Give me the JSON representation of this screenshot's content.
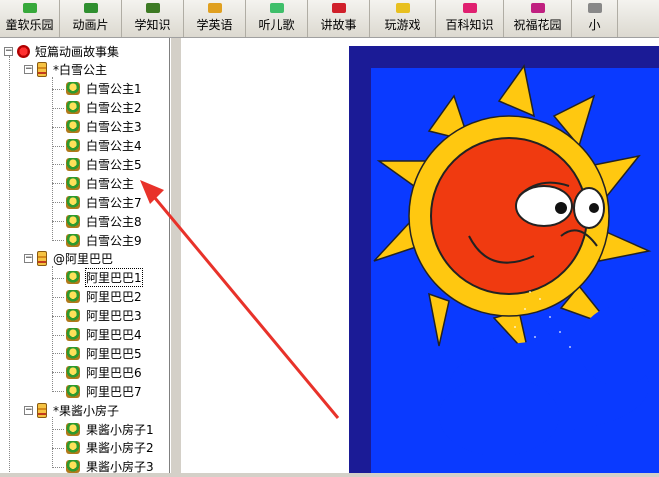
{
  "toolbar": {
    "items": [
      {
        "label": "童软乐园",
        "icon": "kids-park-icon",
        "color": "#37a93b"
      },
      {
        "label": "动画片",
        "icon": "cartoon-icon",
        "color": "#2f8f2f"
      },
      {
        "label": "学知识",
        "icon": "knowledge-icon",
        "color": "#3d7a23"
      },
      {
        "label": "学英语",
        "icon": "english-icon",
        "color": "#e0a020"
      },
      {
        "label": "听儿歌",
        "icon": "song-icon",
        "color": "#3fbf6a"
      },
      {
        "label": "讲故事",
        "icon": "story-icon",
        "color": "#d0202a"
      },
      {
        "label": "玩游戏",
        "icon": "game-icon",
        "color": "#e8c020"
      },
      {
        "label": "百科知识",
        "icon": "encyclopedia-icon",
        "color": "#e02070"
      },
      {
        "label": "祝福花园",
        "icon": "blessing-garden-icon",
        "color": "#c02080"
      },
      {
        "label": "小",
        "icon": "",
        "color": "#888888"
      }
    ]
  },
  "tree": {
    "root": "短篇动画故事集",
    "groups": [
      {
        "label": "*白雪公主",
        "items": [
          "白雪公主1",
          "白雪公主2",
          "白雪公主3",
          "白雪公主4",
          "白雪公主5",
          "白雪公主",
          "白雪公主7",
          "白雪公主8",
          "白雪公主9"
        ]
      },
      {
        "label": "@阿里巴巴",
        "items": [
          "阿里巴巴1",
          "阿里巴巴2",
          "阿里巴巴3",
          "阿里巴巴4",
          "阿里巴巴5",
          "阿里巴巴6",
          "阿里巴巴7"
        ]
      },
      {
        "label": "*果酱小房子",
        "items": [
          "果酱小房子1",
          "果酱小房子2",
          "果酱小房子3"
        ]
      }
    ],
    "selected": "阿里巴巴1"
  },
  "colors": {
    "picture_bg": "#0a3aff",
    "picture_border": "#1b1b96",
    "sun": "#f03a10",
    "rays": "#ffc810",
    "arrow": "#e8322a"
  }
}
